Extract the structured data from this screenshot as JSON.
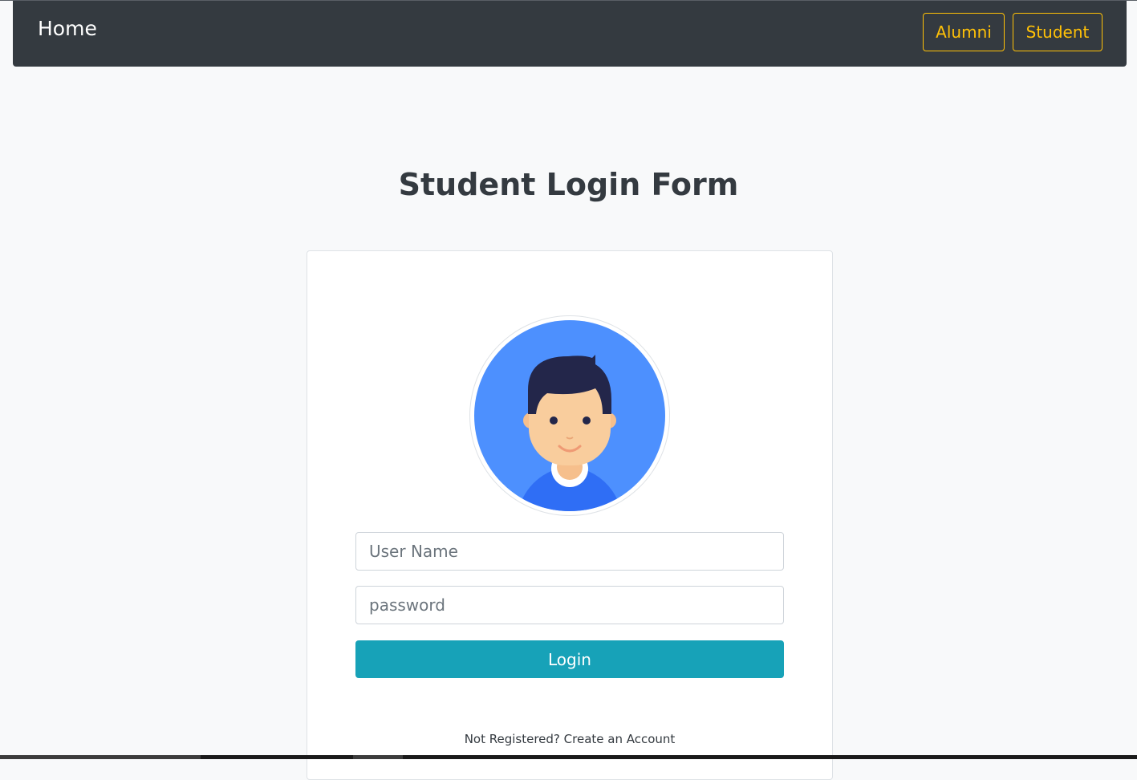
{
  "navbar": {
    "brand": "Home",
    "buttons": [
      {
        "label": "Alumni"
      },
      {
        "label": "Student"
      }
    ],
    "background": "#343a40",
    "accent": "#ffc107"
  },
  "main": {
    "title": "Student Login Form"
  },
  "form": {
    "avatar_icon": "student-avatar-icon",
    "username_placeholder": "User Name",
    "password_placeholder": "password",
    "login_label": "Login",
    "login_color": "#17a2b8",
    "register_prefix": "Not Registered?",
    "register_link": "Create an Account"
  }
}
